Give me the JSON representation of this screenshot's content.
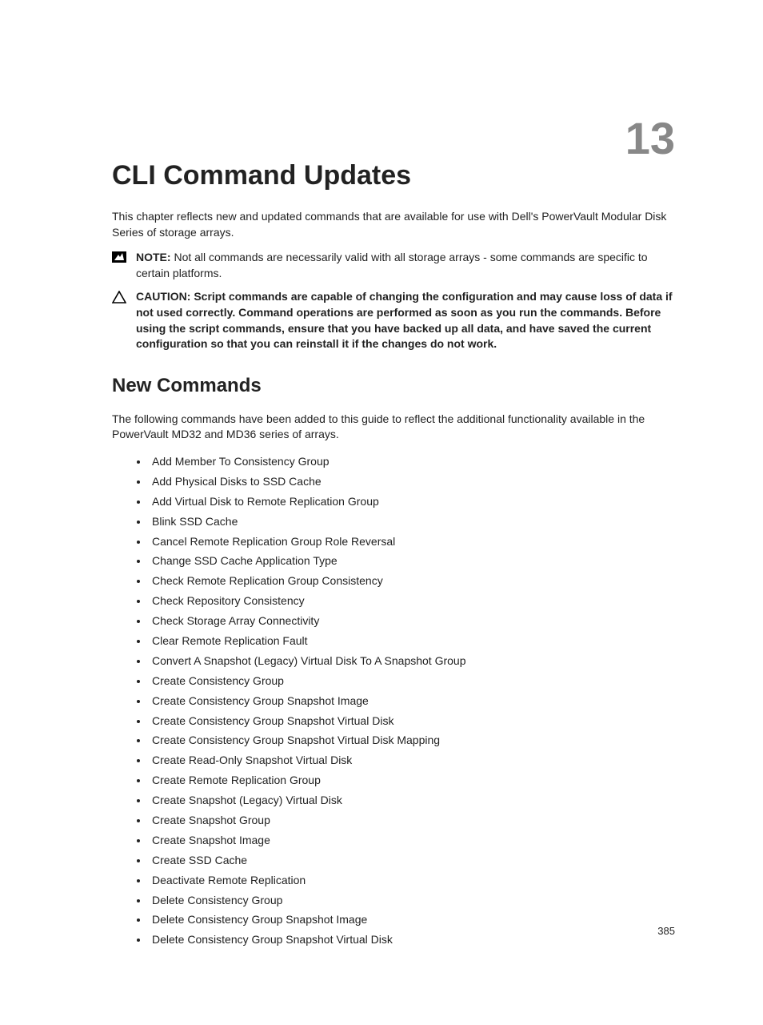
{
  "chapter_number": "13",
  "chapter_title": "CLI Command Updates",
  "intro": "This chapter reflects new and updated commands that are available for use with Dell's PowerVault Modular Disk Series of storage arrays.",
  "note": {
    "label": "NOTE: ",
    "text": "Not all commands are necessarily valid with all storage arrays - some commands are specific to certain platforms."
  },
  "caution": {
    "label": "CAUTION: ",
    "text": "Script commands are capable of changing the configuration and may cause loss of data if not used correctly. Command operations are performed as soon as you run the commands. Before using the script commands, ensure that you have backed up all data, and have saved the current configuration so that you can reinstall it if the changes do not work."
  },
  "section": {
    "heading": "New Commands",
    "intro": "The following commands have been added to this guide to reflect the additional functionality available in the PowerVault MD32 and MD36 series of arrays.",
    "items": [
      "Add Member To Consistency Group",
      "Add Physical Disks to SSD Cache",
      "Add Virtual Disk to Remote Replication Group",
      "Blink SSD Cache",
      "Cancel Remote Replication Group Role Reversal",
      "Change SSD Cache Application Type",
      "Check Remote Replication Group Consistency",
      "Check Repository Consistency",
      "Check Storage Array Connectivity",
      "Clear Remote Replication Fault",
      "Convert A Snapshot (Legacy) Virtual Disk To A Snapshot Group",
      "Create Consistency Group",
      "Create Consistency Group Snapshot Image",
      "Create Consistency Group Snapshot Virtual Disk",
      "Create Consistency Group Snapshot Virtual Disk Mapping",
      "Create Read-Only Snapshot Virtual Disk",
      "Create Remote Replication Group",
      "Create Snapshot (Legacy) Virtual Disk",
      "Create Snapshot Group",
      "Create Snapshot Image",
      "Create SSD Cache",
      "Deactivate Remote Replication",
      "Delete Consistency Group",
      "Delete Consistency Group Snapshot Image",
      "Delete Consistency Group Snapshot Virtual Disk"
    ]
  },
  "page_number": "385"
}
